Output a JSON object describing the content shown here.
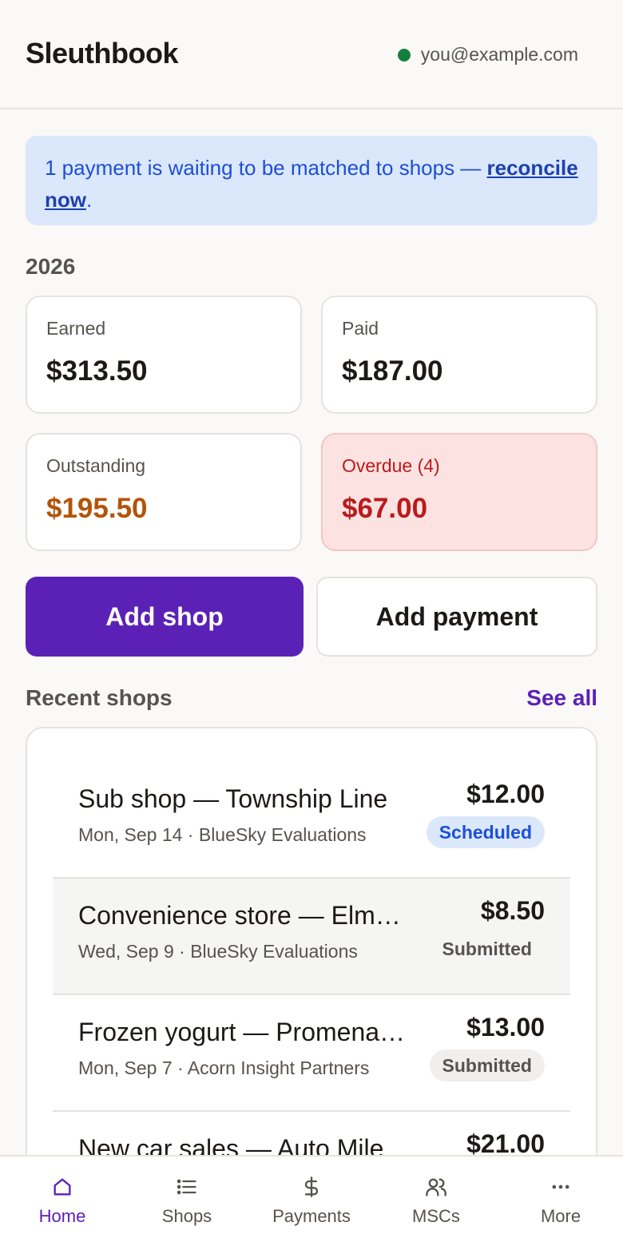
{
  "header": {
    "app_title": "Sleuthbook",
    "user_email": "you@example.com",
    "status_color": "#15803d"
  },
  "banner": {
    "text": "1 payment is waiting to be matched to shops — ",
    "link_text": "reconcile now",
    "suffix": "."
  },
  "summary": {
    "year": "2026",
    "earned": {
      "label": "Earned",
      "value": "$313.50"
    },
    "paid": {
      "label": "Paid",
      "value": "$187.00"
    },
    "outstanding": {
      "label": "Outstanding",
      "value": "$195.50"
    },
    "overdue": {
      "label": "Overdue (4)",
      "value": "$67.00"
    }
  },
  "actions": {
    "add_shop": "Add shop",
    "add_payment": "Add payment"
  },
  "recent": {
    "title": "Recent shops",
    "see_all": "See all",
    "items": [
      {
        "title": "Sub shop — Township Line",
        "subtitle": "Mon, Sep 14 · BlueSky Evaluations",
        "amount": "$12.00",
        "status": "Scheduled"
      },
      {
        "title": "Convenience store — Elm Street",
        "subtitle": "Wed, Sep 9 · BlueSky Evaluations",
        "amount": "$8.50",
        "status": "Submitted"
      },
      {
        "title": "Frozen yogurt — Promenade",
        "subtitle": "Mon, Sep 7 · Acorn Insight Partners",
        "amount": "$13.00",
        "status": "Submitted"
      },
      {
        "title": "New car sales — Auto Mile",
        "subtitle": "",
        "amount": "$21.00",
        "status": ""
      }
    ]
  },
  "tabs": [
    {
      "label": "Home",
      "icon": "home-icon",
      "active": true
    },
    {
      "label": "Shops",
      "icon": "list-icon",
      "active": false
    },
    {
      "label": "Payments",
      "icon": "dollar-icon",
      "active": false
    },
    {
      "label": "MSCs",
      "icon": "users-icon",
      "active": false
    },
    {
      "label": "More",
      "icon": "more-icon",
      "active": false
    }
  ],
  "colors": {
    "accent": "#5b21b6",
    "warning": "#b45309",
    "danger": "#b91c1c",
    "info": "#1d4ed8"
  }
}
